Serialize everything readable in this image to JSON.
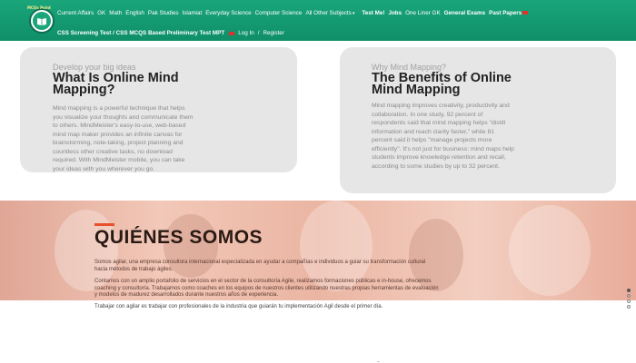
{
  "nav": {
    "logo_text": "MCQs Point",
    "row1": {
      "items": [
        "Current Affairs",
        "GK",
        "Math",
        "English",
        "Pak Studies",
        "Islamiat",
        "Everyday Science",
        "Computer Science",
        "All Other Subjects"
      ],
      "caret": "▾",
      "bold_items": [
        "Test Me!",
        "Jobs",
        "One Liner GK",
        "General Exams",
        "Past Papers"
      ]
    },
    "row2": {
      "bold_text": "CSS Screening Test / CSS MCQS Based Preliminary Test MPT",
      "plain_items": [
        "Log In",
        "Register"
      ],
      "separator": "/"
    }
  },
  "card1": {
    "kicker": "Develop your big ideas",
    "title_line1": "What Is Online Mind",
    "title_line2": "Mapping?",
    "body": [
      "Mind mapping is a powerful technique that helps",
      "you visualize your thoughts and communicate them",
      "to others. MindMeister's easy-to-use, web-based",
      "mind map maker provides an infinite canvas for",
      "brainstorming, note-taking, project planning and",
      "countless other creative tasks, no download",
      "required. With MindMeister mobile, you can take",
      "your ideas with you wherever you go."
    ]
  },
  "card2": {
    "kicker": "Why Mind Mapping?",
    "title_line1": "The Benefits of Online",
    "title_line2": "Mind Mapping",
    "body": [
      "Mind mapping improves creativity, productivity and",
      "collaboration. In one study, 92 percent of",
      "respondents said that mind mapping helps \"distill",
      "information and reach clarity faster,\" while 81",
      "percent said it helps \"manage projects more",
      "efficiently\". It's not just for business: mind maps help",
      "students improve knowledge retention and recall,",
      "according to some studies by up to 32 percent."
    ]
  },
  "hero": {
    "title": "QUIÉNES SOMOS",
    "p1": [
      "Somos agilar, una empresa consultora internacional especializada en ayudar a compañías e individuos a guiar su transformación cultural",
      "hacia métodos de trabajo ágiles."
    ],
    "p2": [
      "Contamos con un amplio portafolio de servicios en el sector de la consultoría Agile, realizamos formaciones públicas e in-house, ofrecemos",
      "coaching y consultoría. Trabajamos como coaches en los equipos de nuestros clientes utilizando nuestras propias herramientas de evaluación",
      "y modelos de madurez desarrollados durante nuestros años de experiencia."
    ],
    "p3": "Trabajar con agilar es trabajar con profesionales de la industria que guiarán tu implementación Agil desde el primer día."
  },
  "colors": {
    "nav_green": "#1aa57a",
    "accent_orange": "#e8512b",
    "card_gray": "#e6e6e6"
  }
}
